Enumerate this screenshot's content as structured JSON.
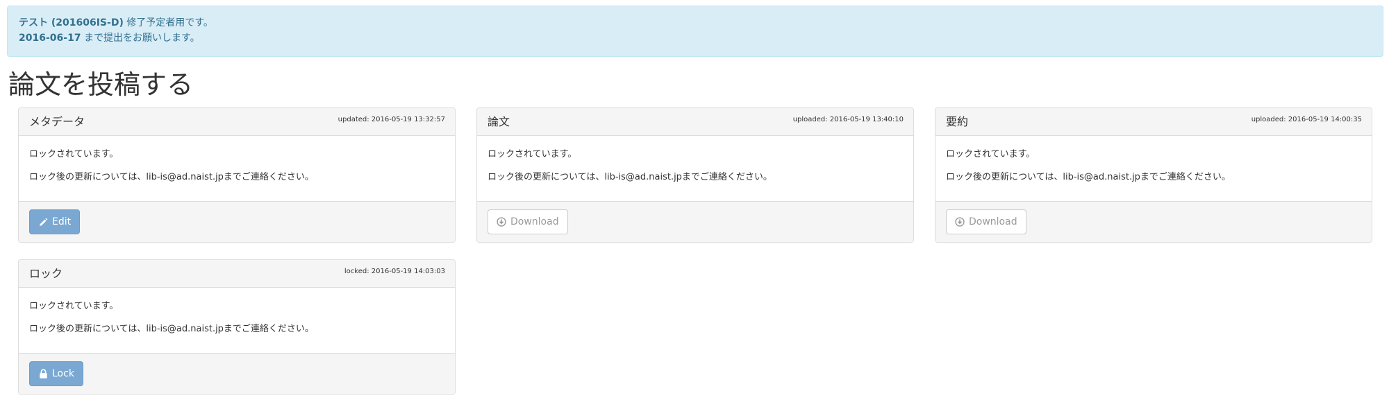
{
  "alert": {
    "line1_test_id": "テスト (201606IS-D)",
    "line1_suffix": " 修了予定者用です。",
    "line2_date": "2016-06-17",
    "line2_suffix": " まで提出をお願いします。"
  },
  "page": {
    "title": "論文を投稿する"
  },
  "panels": {
    "metadata": {
      "title": "メタデータ",
      "meta": "updated: 2016-05-19 13:32:57",
      "body_line1": "ロックされています。",
      "body_line2": "ロック後の更新については、lib-is@ad.naist.jpまでご連絡ください。",
      "button_label": "Edit",
      "button_icon": "pencil-icon"
    },
    "thesis": {
      "title": "論文",
      "meta": "uploaded: 2016-05-19 13:40:10",
      "body_line1": "ロックされています。",
      "body_line2": "ロック後の更新については、lib-is@ad.naist.jpまでご連絡ください。",
      "button_label": "Download",
      "button_icon": "download-circle-icon"
    },
    "abstract": {
      "title": "要約",
      "meta": "uploaded: 2016-05-19 14:00:35",
      "body_line1": "ロックされています。",
      "body_line2": "ロック後の更新については、lib-is@ad.naist.jpまでご連絡ください。",
      "button_label": "Download",
      "button_icon": "download-circle-icon"
    },
    "lock": {
      "title": "ロック",
      "meta": "locked: 2016-05-19 14:03:03",
      "body_line1": "ロックされています。",
      "body_line2": "ロック後の更新については、lib-is@ad.naist.jpまでご連絡ください。",
      "button_label": "Lock",
      "button_icon": "lock-icon"
    }
  },
  "colors": {
    "alert_bg": "#d9edf7",
    "alert_text": "#31708f",
    "primary_button": "#7aa8d2",
    "panel_heading_bg": "#f5f5f5"
  }
}
